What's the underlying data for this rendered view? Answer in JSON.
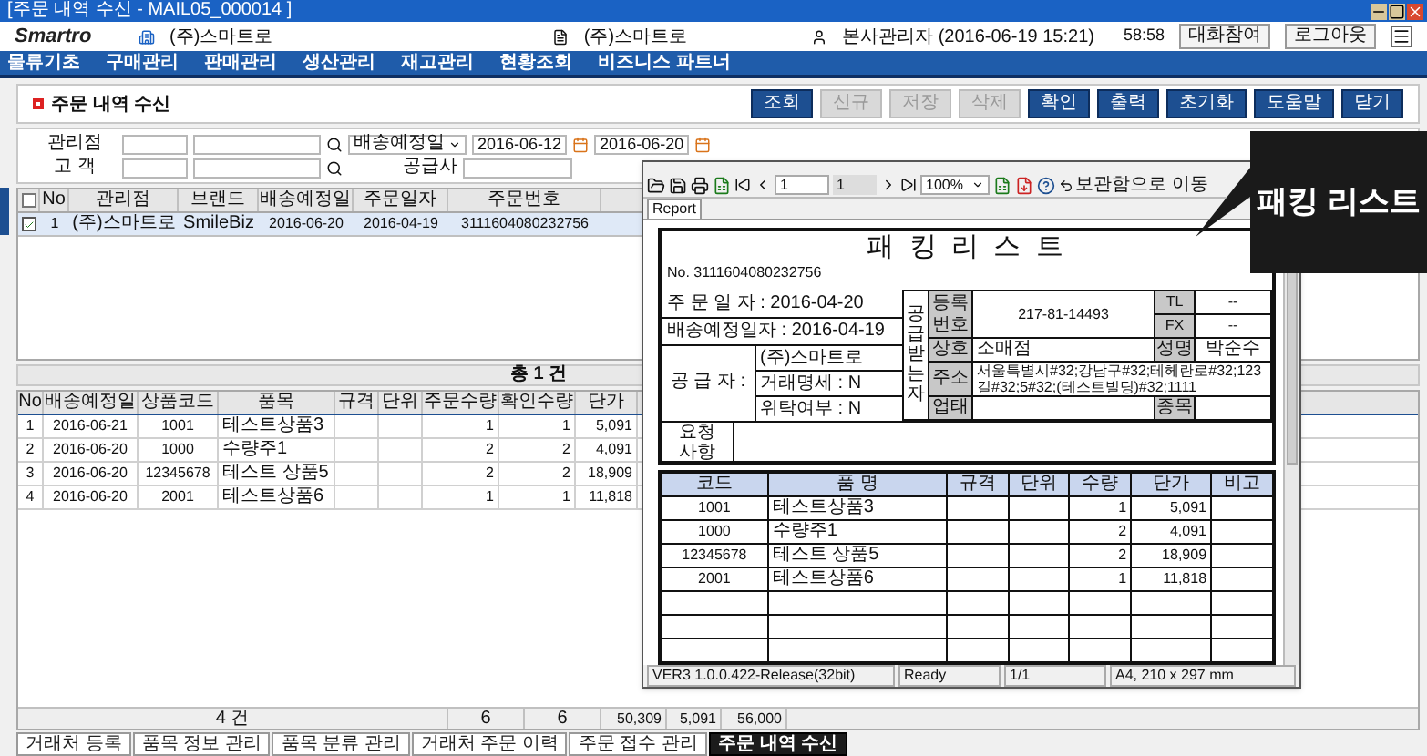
{
  "window": {
    "title": "[주문 내역 수신 - MAIL05_000014 ]"
  },
  "header": {
    "logo": "Smartro",
    "company": "(주)스마트로",
    "company_right": "(주)스마트로",
    "user": "본사관리자 (2016-06-19 15:21)",
    "timer": "58:58",
    "buttons": [
      "대화참여",
      "로그아웃"
    ]
  },
  "nav": [
    "물류기초",
    "구매관리",
    "판매관리",
    "생산관리",
    "재고관리",
    "현황조회",
    "비즈니스 파트너"
  ],
  "page": {
    "title": "주문 내역 수신",
    "buttons": [
      {
        "label": "조회",
        "disabled": false
      },
      {
        "label": "신규",
        "disabled": true
      },
      {
        "label": "저장",
        "disabled": true
      },
      {
        "label": "삭제",
        "disabled": true
      },
      {
        "label": "확인",
        "disabled": false
      },
      {
        "label": "출력",
        "disabled": false
      },
      {
        "label": "초기화",
        "disabled": false
      },
      {
        "label": "도움말",
        "disabled": false
      },
      {
        "label": "닫기",
        "disabled": false
      }
    ]
  },
  "filters": {
    "branch_label": "관리점",
    "date_type": "배송예정일",
    "date_from": "2016-06-12",
    "date_to": "2016-06-20",
    "customer_label": "고 객",
    "supplier_label": "공급사"
  },
  "order_grid": {
    "all_checked": false,
    "columns": [
      "No",
      "관리점",
      "브랜드",
      "배송예정일",
      "주문일자",
      "주문번호"
    ],
    "rows": [
      {
        "checked": true,
        "cells": [
          "1",
          "(주)스마트로",
          "SmileBiz",
          "2016-06-20",
          "2016-04-19",
          "3111604080232756"
        ]
      }
    ],
    "total": "총 1 건"
  },
  "item_grid": {
    "columns": [
      "No",
      "배송예정일",
      "상품코드",
      "품목",
      "규격",
      "단위",
      "주문수량",
      "확인수량",
      "단가"
    ],
    "rows": [
      [
        "1",
        "2016-06-21",
        "1001",
        "테스트상품3",
        "",
        "",
        "1",
        "1",
        "5,091"
      ],
      [
        "2",
        "2016-06-20",
        "1000",
        "수량주1",
        "",
        "",
        "2",
        "2",
        "4,091"
      ],
      [
        "3",
        "2016-06-20",
        "12345678",
        "테스트 상품5",
        "",
        "",
        "2",
        "2",
        "18,909"
      ],
      [
        "4",
        "2016-06-20",
        "2001",
        "테스트상품6",
        "",
        "",
        "1",
        "1",
        "11,818"
      ]
    ],
    "footer": [
      "4 건",
      "6",
      "6"
    ],
    "footer_amounts": [
      "50,309",
      "5,091",
      "56,000"
    ]
  },
  "report": {
    "toolbar": {
      "page": "1",
      "page_total": "1",
      "zoom": "100%",
      "move_label": "보관함으로 이동"
    },
    "tab": "Report",
    "title": "패 킹 리 스 트",
    "number": "No. 3111604080232756",
    "order_date": "주 문 일 자 : 2016-04-20",
    "delivery_date": "배송예정일자 : 2016-04-19",
    "supplier_label": "공 급 자 :",
    "supplier_lines": [
      "(주)스마트로",
      "거래명세 : N",
      "위탁여부 : N"
    ],
    "request_label": "요청 사항",
    "receiver_label": "공급받는자",
    "receiver": {
      "reg_label": "등록 번호",
      "reg_value": "217-81-14493",
      "tel_label": "TL",
      "tel_value": "--",
      "fax_label": "FX",
      "fax_value": "--",
      "name_label": "상호",
      "name_value": "소매점",
      "ceo_label": "성명",
      "ceo_value": "박순수",
      "addr_label": "주소",
      "addr_value": "서울특별시#32;강남구#32;테헤란로#32;123길#32;5#32;(테스트빌딩)#32;1111",
      "biz_label": "업태",
      "item_label": "종목"
    },
    "items": {
      "columns": [
        "코드",
        "품 명",
        "규격",
        "단위",
        "수량",
        "단가",
        "비고"
      ],
      "rows": [
        [
          "1001",
          "테스트상품3",
          "",
          "",
          "1",
          "5,091",
          ""
        ],
        [
          "1000",
          "수량주1",
          "",
          "",
          "2",
          "4,091",
          ""
        ],
        [
          "12345678",
          "테스트 상품5",
          "",
          "",
          "2",
          "18,909",
          ""
        ],
        [
          "2001",
          "테스트상품6",
          "",
          "",
          "1",
          "11,818",
          ""
        ]
      ]
    },
    "status": [
      "VER3 1.0.0.422-Release(32bit)",
      "Ready",
      "1/1",
      "A4, 210 x 297 mm"
    ]
  },
  "callout": {
    "text": "패킹 리스트"
  },
  "bottom_tabs": [
    {
      "label": "거래처 등록",
      "selected": false
    },
    {
      "label": "품목 정보 관리",
      "selected": false
    },
    {
      "label": "품목 분류 관리",
      "selected": false
    },
    {
      "label": "거래처 주문 이력",
      "selected": false
    },
    {
      "label": "주문 접수 관리",
      "selected": false
    },
    {
      "label": "주문 내역 수신",
      "selected": true
    }
  ]
}
